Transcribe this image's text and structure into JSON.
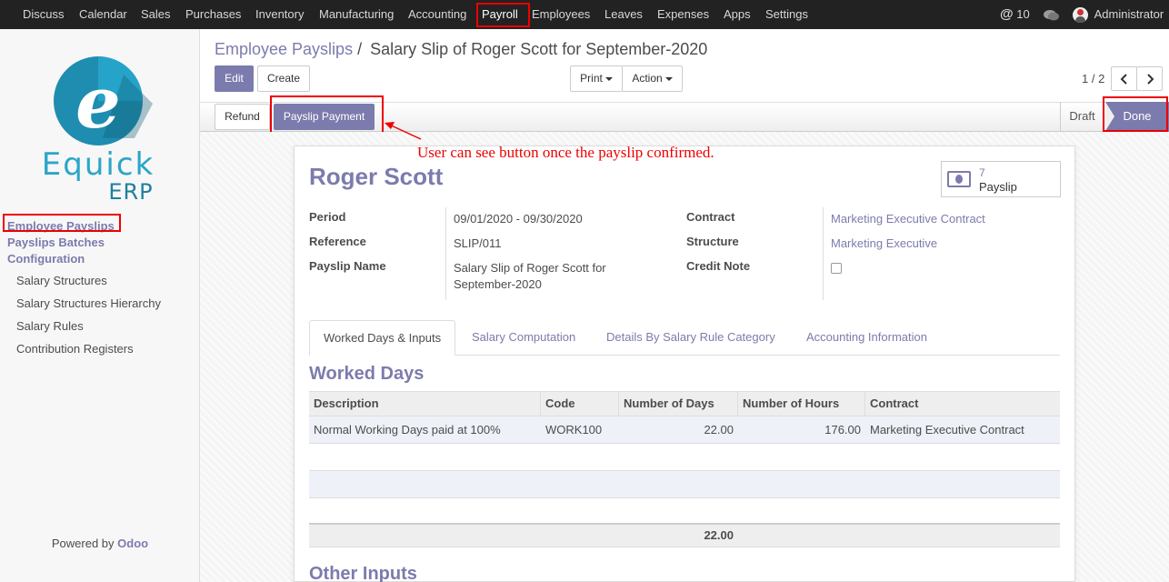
{
  "navbar": {
    "menus": [
      "Discuss",
      "Calendar",
      "Sales",
      "Purchases",
      "Inventory",
      "Manufacturing",
      "Accounting",
      "Payroll",
      "Employees",
      "Leaves",
      "Expenses",
      "Apps",
      "Settings"
    ],
    "active_menu": "Payroll",
    "messages_count": "10",
    "user": "Administrator"
  },
  "sidebar": {
    "logo_text_top": "Equick",
    "logo_text_bottom": "ERP",
    "logo_letter": "e",
    "main_links": [
      "Employee Payslips",
      "Payslips Batches",
      "Configuration"
    ],
    "sub_links": [
      "Salary Structures",
      "Salary Structures Hierarchy",
      "Salary Rules",
      "Contribution Registers"
    ],
    "powered_prefix": "Powered by",
    "powered_brand": "Odoo"
  },
  "breadcrumb": {
    "parent": "Employee Payslips",
    "separator": "/",
    "current": "Salary Slip of Roger Scott for September-2020"
  },
  "buttons": {
    "edit": "Edit",
    "create": "Create",
    "print": "Print",
    "action": "Action",
    "refund": "Refund",
    "payslip_payment": "Payslip Payment"
  },
  "pager": {
    "text": "1 / 2"
  },
  "status": {
    "draft": "Draft",
    "done": "Done",
    "current": "Done"
  },
  "annotation": "User can see button once the payslip confirmed.",
  "form": {
    "employee_name": "Roger Scott",
    "stat": {
      "count": "7",
      "label": "Payslip"
    },
    "left_fields": [
      {
        "label": "Period",
        "value": "09/01/2020 - 09/30/2020"
      },
      {
        "label": "Reference",
        "value": "SLIP/011"
      },
      {
        "label": "Payslip Name",
        "value_line1": "Salary Slip of Roger Scott for",
        "value_line2": "September-2020"
      }
    ],
    "right_fields": [
      {
        "label": "Contract",
        "value": "Marketing Executive Contract"
      },
      {
        "label": "Structure",
        "value": "Marketing Executive"
      },
      {
        "label": "Credit Note",
        "checked": false
      }
    ]
  },
  "tabs": [
    "Worked Days & Inputs",
    "Salary Computation",
    "Details By Salary Rule Category",
    "Accounting Information"
  ],
  "active_tab": "Worked Days & Inputs",
  "worked_days": {
    "title": "Worked Days",
    "columns": [
      "Description",
      "Code",
      "Number of Days",
      "Number of Hours",
      "Contract"
    ],
    "rows": [
      {
        "description": "Normal Working Days paid at 100%",
        "code": "WORK100",
        "days": "22.00",
        "hours": "176.00",
        "contract": "Marketing Executive Contract"
      }
    ],
    "total_days": "22.00"
  },
  "other_inputs": {
    "title": "Other Inputs"
  },
  "colors": {
    "brand": "#7c7bad",
    "navbar": "#222222",
    "annotation": "#ee0000"
  }
}
